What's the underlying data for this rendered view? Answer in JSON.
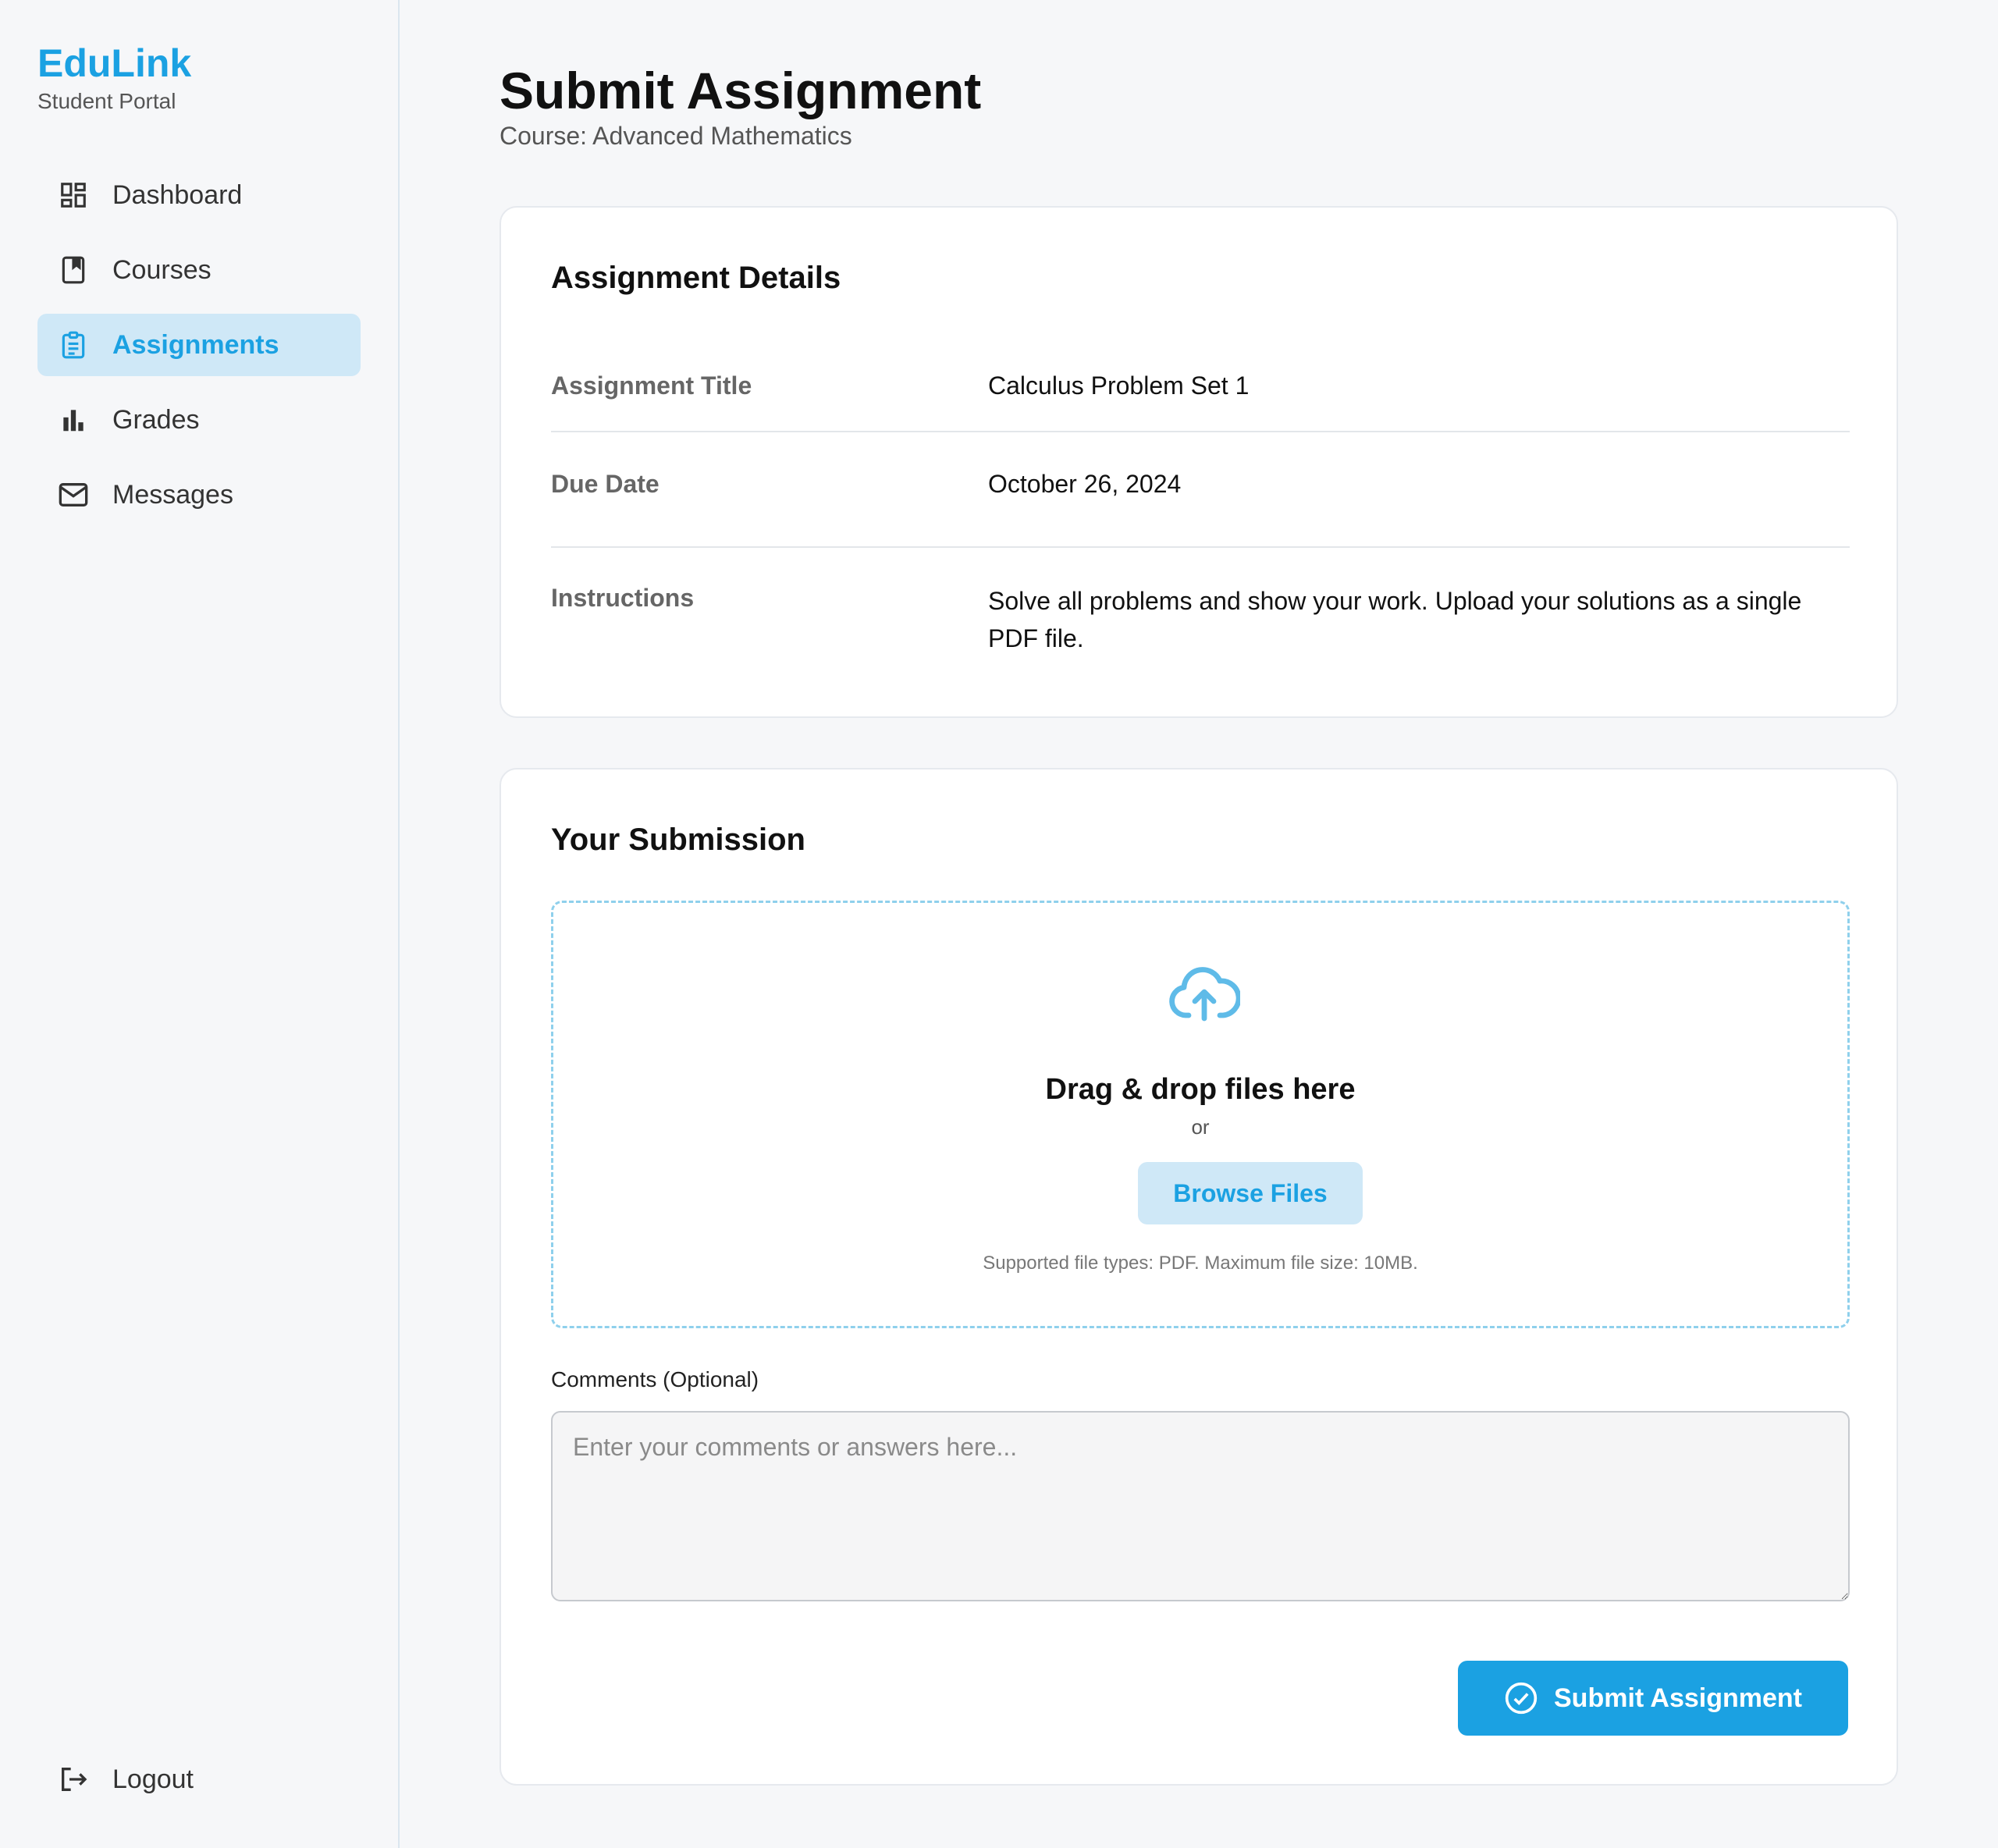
{
  "sidebar": {
    "brand": "EduLink",
    "subtitle": "Student Portal",
    "items": [
      {
        "label": "Dashboard",
        "icon": "dashboard-icon"
      },
      {
        "label": "Courses",
        "icon": "book-icon"
      },
      {
        "label": "Assignments",
        "icon": "clipboard-icon",
        "active": true
      },
      {
        "label": "Grades",
        "icon": "bar-chart-icon"
      },
      {
        "label": "Messages",
        "icon": "mail-icon"
      }
    ],
    "logout": "Logout"
  },
  "header": {
    "title": "Submit Assignment",
    "course": "Course: Advanced Mathematics"
  },
  "details": {
    "title": "Assignment Details",
    "rows": [
      {
        "label": "Assignment Title",
        "value": "Calculus Problem Set 1"
      },
      {
        "label": "Due Date",
        "value": "October 26, 2024"
      },
      {
        "label": "Instructions",
        "value": "Solve all problems and show your work. Upload your solutions as a single PDF file."
      }
    ]
  },
  "submission": {
    "title": "Your Submission",
    "dropzone": {
      "icon": "cloud-upload-icon",
      "title": "Drag & drop files here",
      "or": "or",
      "browse_label": "Browse Files",
      "note": "Supported file types: PDF. Maximum file size: 10MB."
    },
    "comments_label": "Comments (Optional)",
    "comments_placeholder": "Enter your comments or answers here...",
    "comments_value": "",
    "submit_label": "Submit Assignment"
  },
  "colors": {
    "accent": "#1ba1e2",
    "accent_light": "#cfe8f7",
    "dropzone_border": "#8fd0ec",
    "background": "#f6f7f9"
  }
}
